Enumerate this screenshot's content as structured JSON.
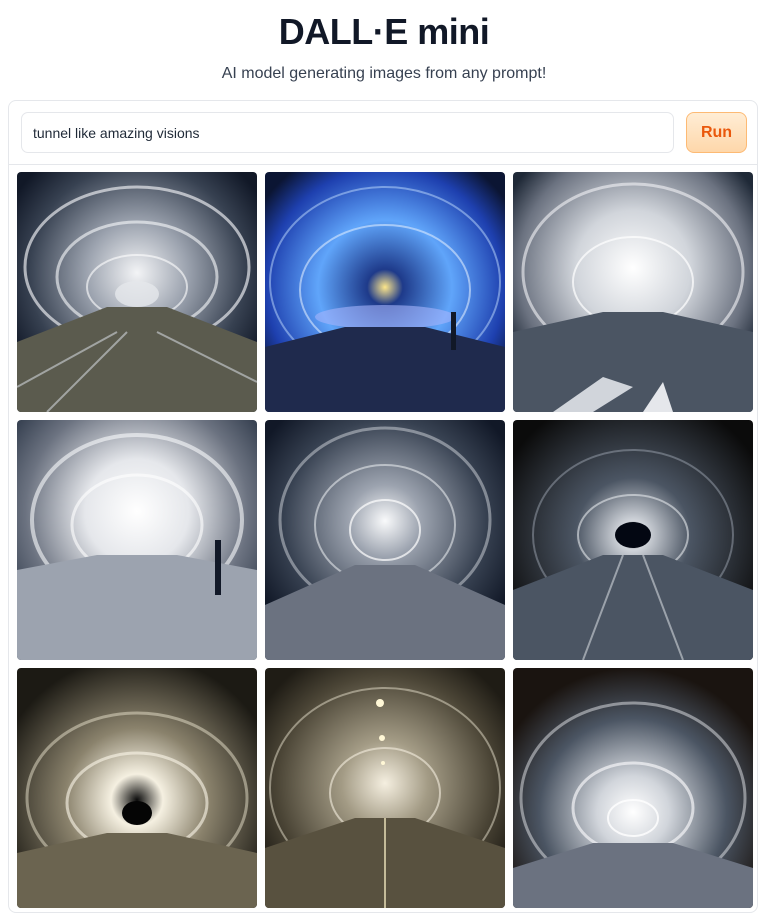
{
  "header": {
    "title": "DALL·E mini",
    "subtitle": "AI model generating images from any prompt!"
  },
  "prompt": {
    "value": "tunnel like amazing visions",
    "placeholder": ""
  },
  "run_button": {
    "label": "Run"
  },
  "gallery": {
    "images": [
      {
        "name": "generated-image-1",
        "palette": "gray"
      },
      {
        "name": "generated-image-2",
        "palette": "blue"
      },
      {
        "name": "generated-image-3",
        "palette": "white"
      },
      {
        "name": "generated-image-4",
        "palette": "white"
      },
      {
        "name": "generated-image-5",
        "palette": "gray"
      },
      {
        "name": "generated-image-6",
        "palette": "dark"
      },
      {
        "name": "generated-image-7",
        "palette": "sepia"
      },
      {
        "name": "generated-image-8",
        "palette": "sepia"
      },
      {
        "name": "generated-image-9",
        "palette": "gray"
      }
    ]
  },
  "colors": {
    "run_text": "#ea580c",
    "run_bg": "#fed7aa",
    "border": "#e5e7eb"
  }
}
